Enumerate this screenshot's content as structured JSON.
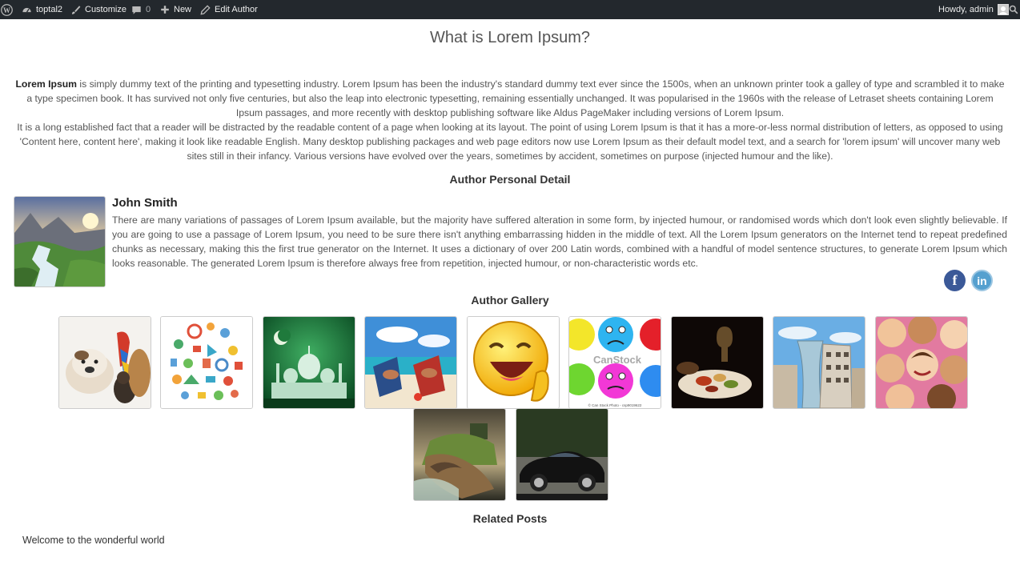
{
  "adminbar": {
    "site_name": "toptal2",
    "customize": "Customize",
    "comments_count": "0",
    "new": "New",
    "edit": "Edit Author",
    "howdy": "Howdy, admin"
  },
  "page": {
    "title": "What is Lorem Ipsum?",
    "intro_bold": "Lorem Ipsum",
    "intro_p1": " is simply dummy text of the printing and typesetting industry. Lorem Ipsum has been the industry's standard dummy text ever since the 1500s, when an unknown printer took a galley of type and scrambled it to make a type specimen book. It has survived not only five centuries, but also the leap into electronic typesetting, remaining essentially unchanged. It was popularised in the 1960s with the release of Letraset sheets containing Lorem Ipsum passages, and more recently with desktop publishing software like Aldus PageMaker including versions of Lorem Ipsum.",
    "intro_p2": "It is a long established fact that a reader will be distracted by the readable content of a page when looking at its layout. The point of using Lorem Ipsum is that it has a more-or-less normal distribution of letters, as opposed to using 'Content here, content here', making it look like readable English. Many desktop publishing packages and web page editors now use Lorem Ipsum as their default model text, and a search for 'lorem ipsum' will uncover many web sites still in their infancy. Various versions have evolved over the years, sometimes by accident, sometimes on purpose (injected humour and the like)."
  },
  "author": {
    "heading": "Author Personal Detail",
    "name": "John Smith",
    "bio": "There are many variations of passages of Lorem Ipsum available, but the majority have suffered alteration in some form, by injected humour, or randomised words which don't look even slightly believable. If you are going to use a passage of Lorem Ipsum, you need to be sure there isn't anything embarrassing hidden in the middle of text. All the Lorem Ipsum generators on the Internet tend to repeat predefined chunks as necessary, making this the first true generator on the Internet. It uses a dictionary of over 200 Latin words, combined with a handful of model sentence structures, to generate Lorem Ipsum which looks reasonable. The generated Lorem Ipsum is therefore always free from repetition, injected humour, or non-characteristic words etc.",
    "social": {
      "facebook": "f",
      "linkedin": "in"
    }
  },
  "gallery": {
    "heading": "Author Gallery",
    "watermark": "CanStock",
    "watermark_small": "© Can Stock Photo - csp9019622"
  },
  "related": {
    "heading": "Related Posts",
    "items": [
      "Welcome to the wonderful world"
    ]
  },
  "colors": {
    "adminbar_bg": "#23282d",
    "facebook": "#3b5998",
    "linkedin": "#55a0cf"
  }
}
